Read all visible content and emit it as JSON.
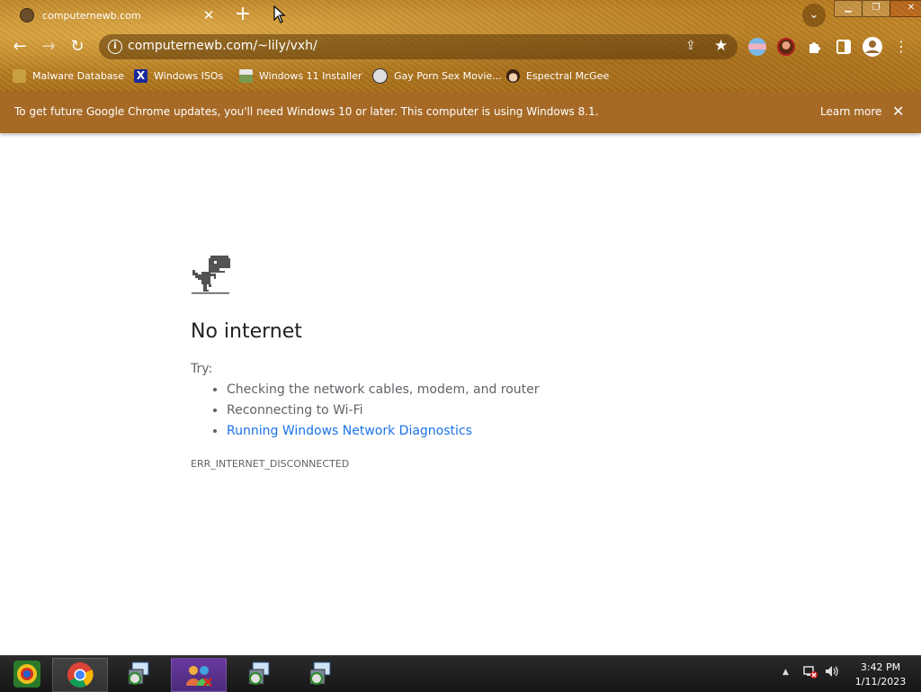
{
  "tab": {
    "title": "computernewb.com",
    "close": "✕"
  },
  "toolbar": {
    "newtab": "+",
    "back": "←",
    "forward": "→",
    "reload": "↻",
    "info": "i",
    "url": "computernewb.com/~lily/vxh/",
    "tab_search": "⌄",
    "minimize": "▁",
    "restore": "❐",
    "close": "✕"
  },
  "bookmarks": [
    {
      "label": "Malware Database",
      "icon": "malware-database-icon",
      "color": "#c8a040"
    },
    {
      "label": "Windows ISOs",
      "icon": "windows-isos-icon",
      "color": "#1a2a9c"
    },
    {
      "label": "Windows 11 Installer",
      "icon": "windows-11-installer-icon",
      "color": "#7a9a50"
    },
    {
      "label": "Gay Porn Sex Movie...",
      "icon": "globe-bookmark-icon",
      "color": "#555555"
    },
    {
      "label": "Espectral McGee",
      "icon": "character-bookmark-icon",
      "color": "#6a4020"
    }
  ],
  "infobar": {
    "message": "To get future Google Chrome updates, you'll need Windows 10 or later. This computer is using Windows 8.1.",
    "learn_more": "Learn more",
    "close": "✕"
  },
  "error": {
    "heading": "No internet",
    "try": "Try:",
    "suggestions": [
      "Checking the network cables, modem, and router",
      "Reconnecting to Wi-Fi"
    ],
    "diagnostics_link": "Running Windows Network Diagnostics",
    "code": "ERR_INTERNET_DISCONNECTED"
  },
  "taskbar": {
    "items": [
      "start-icon",
      "chrome-icon",
      "setup-installer-icon",
      "people-app-icon",
      "setup-installer-icon",
      "setup-installer-icon"
    ],
    "show_hidden": "▲",
    "time": "3:42 PM",
    "date": "1/11/2023"
  },
  "colors": {
    "infobar": "#a66a26",
    "link": "#1a73e8",
    "text": "#202124",
    "muted": "#5f6368"
  }
}
